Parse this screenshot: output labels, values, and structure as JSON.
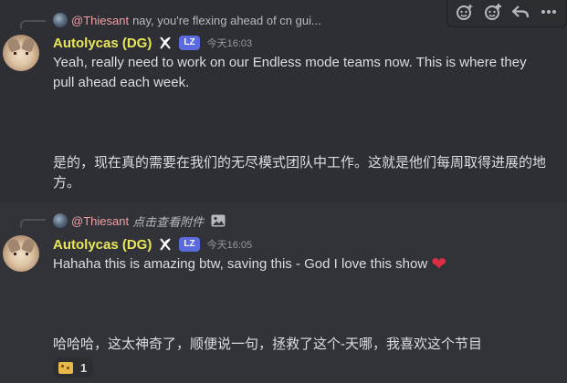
{
  "toolbar": {
    "icons": [
      "add-super-reaction-icon",
      "add-reaction-icon",
      "reply-icon",
      "more-options-icon"
    ]
  },
  "messages": [
    {
      "reply": {
        "name": "@Thiesant",
        "text": "nay, you're flexing ahead of cn gui..."
      },
      "author": {
        "name": "Autolycas (DG)",
        "badge": "LZ",
        "name_color": "#e9e65a"
      },
      "timestamp": "今天16:03",
      "content": "Yeah, really need to work on our Endless mode teams now. This is where they pull ahead each week.",
      "translation": "是的，现在真的需要在我们的无尽模式团队中工作。这就是他们每周取得进展的地方。"
    },
    {
      "reply": {
        "name": "@Thiesant",
        "text": "点击查看附件"
      },
      "author": {
        "name": "Autolycas (DG)",
        "badge": "LZ",
        "name_color": "#e9e65a"
      },
      "timestamp": "今天16:05",
      "content": "Hahaha this is amazing btw, saving this - God I love this show",
      "translation": "哈哈哈，这太神奇了，顺便说一句，拯救了这个-天哪，我喜欢这个节目",
      "reaction": {
        "emoji": "cheese-emoji",
        "count": "1"
      }
    }
  ],
  "colors": {
    "background": "#323339",
    "hover_background": "#2e2f35",
    "reply_name": "#f0a0a3",
    "badge": "#5b6adf",
    "heart": "#dd2e44"
  }
}
